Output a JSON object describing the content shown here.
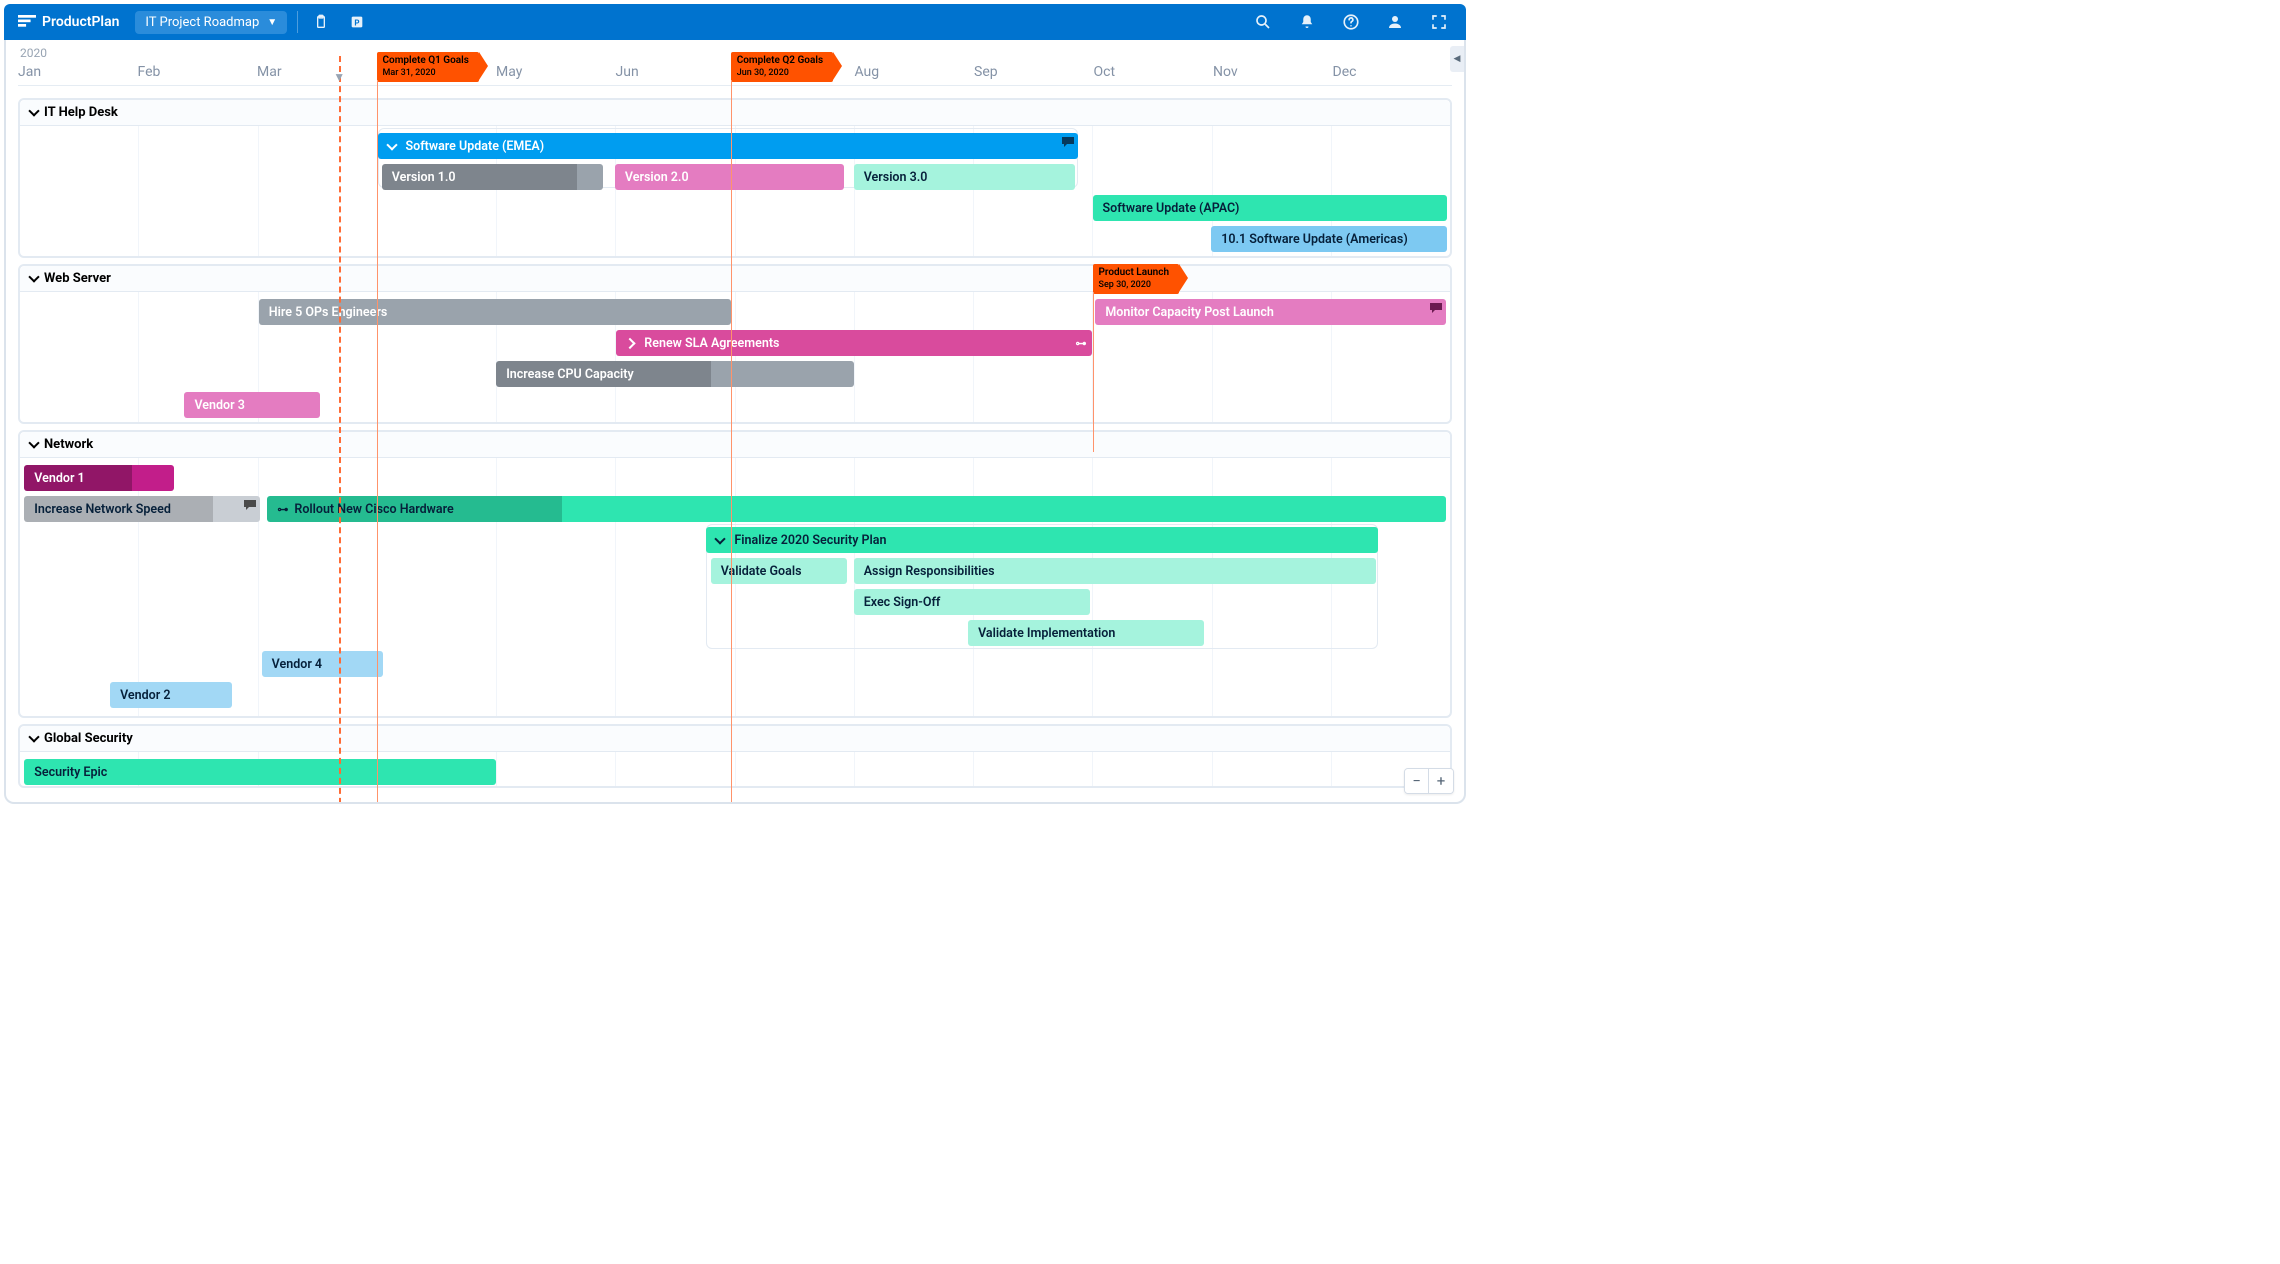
{
  "app": {
    "name": "ProductPlan",
    "plan": "IT Project Roadmap"
  },
  "year": "2020",
  "months": [
    "Jan",
    "Feb",
    "Mar",
    "",
    "May",
    "Jun",
    "",
    "Aug",
    "Sep",
    "Oct",
    "Nov",
    "Dec"
  ],
  "milestones": {
    "q1": {
      "title": "Complete Q1 Goals",
      "date": "Mar 31, 2020"
    },
    "q2": {
      "title": "Complete Q2 Goals",
      "date": "Jun 30, 2020"
    },
    "launch": {
      "title": "Product Launch",
      "date": "Sep 30, 2020"
    }
  },
  "lanes": {
    "helpdesk": {
      "title": "IT Help Desk",
      "emea": "Software Update (EMEA)",
      "v1": "Version 1.0",
      "v2": "Version 2.0",
      "v3": "Version 3.0",
      "apac": "Software Update (APAC)",
      "americas": "10.1 Software Update (Americas)"
    },
    "web": {
      "title": "Web Server",
      "hire": "Hire 5 OPs Engineers",
      "monitor": "Monitor Capacity Post Launch",
      "sla": "Renew SLA Agreements",
      "cpu": "Increase CPU Capacity",
      "vendor3": "Vendor 3"
    },
    "network": {
      "title": "Network",
      "vendor1": "Vendor 1",
      "netspeed": "Increase Network Speed",
      "cisco": "Rollout New Cisco Hardware",
      "secplan": "Finalize 2020 Security Plan",
      "goals": "Validate Goals",
      "assign": "Assign Responsibilities",
      "signoff": "Exec Sign-Off",
      "impl": "Validate Implementation",
      "vendor4": "Vendor 4",
      "vendor2": "Vendor 2"
    },
    "global": {
      "title": "Global Security",
      "epic": "Security Epic"
    }
  }
}
